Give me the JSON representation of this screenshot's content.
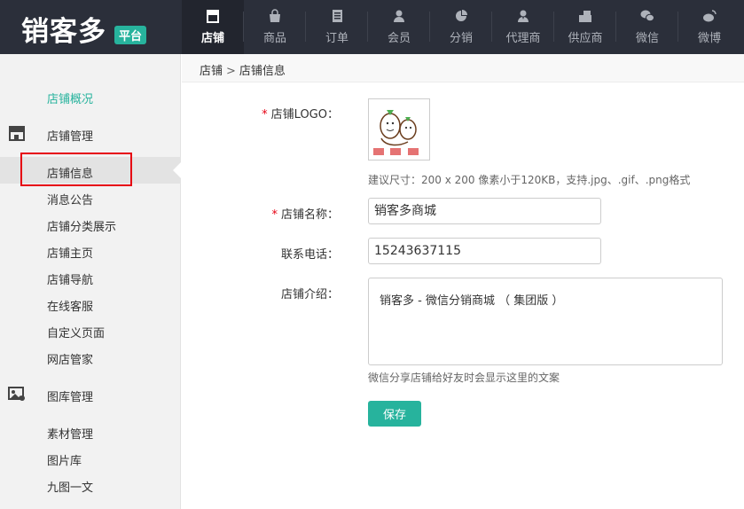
{
  "brand": {
    "name": "销客多",
    "badge": "平台"
  },
  "nav": [
    {
      "label": "店铺",
      "icon": "store-icon",
      "active": true
    },
    {
      "label": "商品",
      "icon": "bag-icon"
    },
    {
      "label": "订单",
      "icon": "order-icon"
    },
    {
      "label": "会员",
      "icon": "member-icon"
    },
    {
      "label": "分销",
      "icon": "pie-chart-icon"
    },
    {
      "label": "代理商",
      "icon": "agent-icon"
    },
    {
      "label": "供应商",
      "icon": "supplier-icon"
    },
    {
      "label": "微信",
      "icon": "wechat-icon"
    },
    {
      "label": "微博",
      "icon": "weibo-icon"
    }
  ],
  "sidebar": {
    "overview": "店铺概况",
    "group_store": "店铺管理",
    "store_items": [
      "店铺信息",
      "消息公告",
      "店铺分类展示",
      "店铺主页",
      "店铺导航",
      "在线客服",
      "自定义页面",
      "网店管家"
    ],
    "group_gallery": "图库管理",
    "gallery_items": [
      "素材管理",
      "图片库",
      "九图一文"
    ]
  },
  "breadcrumb": {
    "root": "店铺",
    "current": "店铺信息"
  },
  "form": {
    "logo_label": "店铺LOGO：",
    "logo_hint": "建议尺寸：200 x 200 像素小于120KB，支持.jpg、.gif、.png格式",
    "name_label": "店铺名称：",
    "name_value": "销客多商城",
    "phone_label": "联系电话：",
    "phone_value": "15243637115",
    "intro_label": "店铺介绍：",
    "intro_value": "销客多 - 微信分销商城 （ 集团版 ）",
    "intro_hint": "微信分享店铺给好友时会显示这里的文案",
    "save_label": "保存"
  },
  "colors": {
    "accent": "#27b39d",
    "topbar": "#2b2f3a",
    "required": "#e60012"
  }
}
